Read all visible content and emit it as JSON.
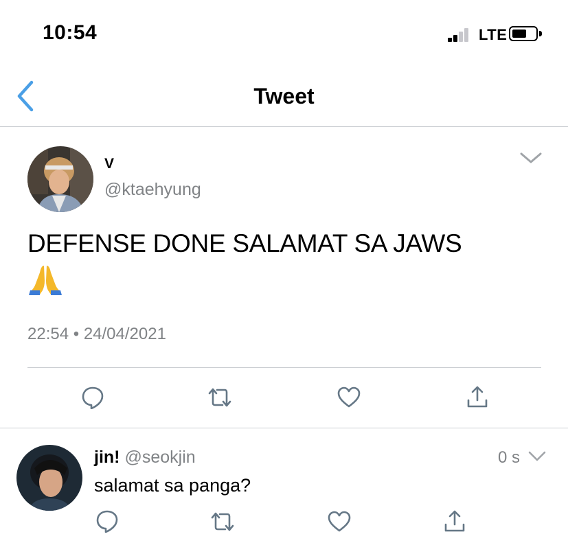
{
  "status_bar": {
    "time": "10:54",
    "network": "LTE"
  },
  "header": {
    "title": "Tweet",
    "back_icon": "chevron-left-icon"
  },
  "tweet": {
    "display_name": "V",
    "handle": "@ktaehyung",
    "text": "DEFENSE DONE SALAMAT SA JAWS",
    "emoji": "folded-hands-emoji",
    "time": "22:54",
    "separator": "•",
    "date": "24/04/2021",
    "actions": [
      "reply-icon",
      "retweet-icon",
      "like-icon",
      "share-icon"
    ]
  },
  "reply": {
    "display_name": "jin!",
    "handle": "@seokjin",
    "age": "0 s",
    "text": "salamat sa panga?",
    "actions": [
      "reply-icon",
      "retweet-icon",
      "like-icon",
      "share-icon"
    ]
  },
  "colors": {
    "accent": "#1da1f2",
    "muted": "#808386",
    "divider": "#c9ccd1"
  }
}
